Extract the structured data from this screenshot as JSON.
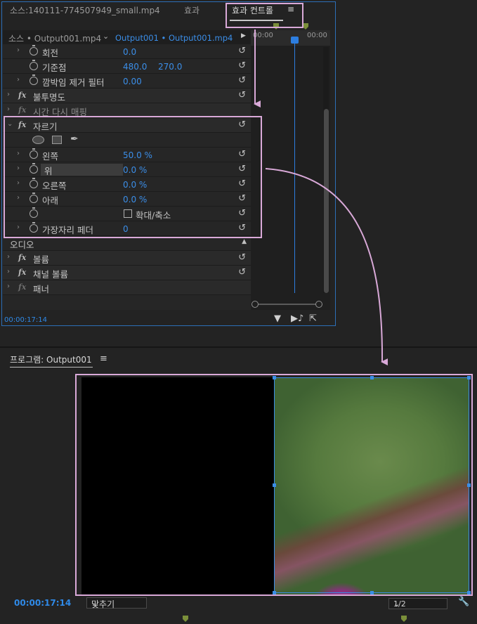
{
  "effect_controls": {
    "tabs": [
      {
        "label": "소스:140111-774507949_small.mp4"
      },
      {
        "label": "효과"
      },
      {
        "label": "효과 컨트롤"
      }
    ],
    "menu_icon": "≡",
    "source_clip": "소스 • Output001.mp4",
    "sequence_clip": "Output001 • Output001.mp4",
    "timeline_times": [
      "00:00",
      "00:00"
    ],
    "rows": [
      {
        "label": "회전",
        "values": [
          "0.0"
        ]
      },
      {
        "label": "기준점",
        "values": [
          "480.0",
          "270.0"
        ]
      },
      {
        "label": "깜박임 제거 필터",
        "values": [
          "0.00"
        ]
      },
      {
        "label": "불투명도"
      },
      {
        "label": "시간 다시 매핑"
      },
      {
        "label": "자르기"
      },
      {
        "label": "왼쪽",
        "values": [
          "50.0 %"
        ]
      },
      {
        "label": "위",
        "values": [
          "0.0 %"
        ]
      },
      {
        "label": "오른쪽",
        "values": [
          "0.0 %"
        ]
      },
      {
        "label": "아래",
        "values": [
          "0.0 %"
        ]
      },
      {
        "label": "확대/축소"
      },
      {
        "label": "가장자리 페더",
        "values": [
          "0"
        ]
      },
      {
        "label": "오디오"
      },
      {
        "label": "볼륨"
      },
      {
        "label": "채널 볼륨"
      },
      {
        "label": "패너"
      }
    ],
    "timecode": "00:00:17:14"
  },
  "program_monitor": {
    "title": "프로그램: Output001",
    "menu_icon": "≡",
    "timecode": "00:00:17:14",
    "fit_option": "맞추기",
    "resolution": "1/2"
  },
  "colors": {
    "accent_blue": "#3b8ee8",
    "annotation_pink": "#d9a9d8",
    "marker_green": "#7b8f3a"
  }
}
